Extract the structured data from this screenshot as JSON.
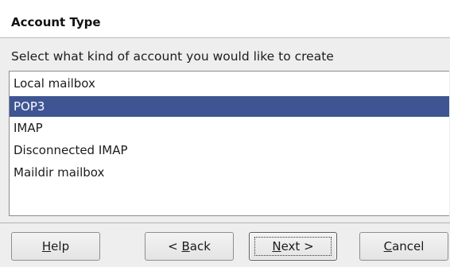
{
  "header": {
    "title": "Account Type"
  },
  "instruction": "Select what kind of account you would like to create",
  "account_types": {
    "items": [
      {
        "label": "Local mailbox",
        "selected": false
      },
      {
        "label": "POP3",
        "selected": true
      },
      {
        "label": "IMAP",
        "selected": false
      },
      {
        "label": "Disconnected IMAP",
        "selected": false
      },
      {
        "label": "Maildir mailbox",
        "selected": false
      }
    ]
  },
  "buttons": {
    "help": {
      "label": "Help",
      "mnemonic": "H"
    },
    "back": {
      "label": "< Back",
      "mnemonic": "B"
    },
    "next": {
      "label": "Next >",
      "mnemonic": "N"
    },
    "cancel": {
      "label": "Cancel",
      "mnemonic": "C"
    }
  },
  "colors": {
    "selection": "#3f5593",
    "selection_text": "#ffffff",
    "window_bg": "#eeeeee"
  }
}
